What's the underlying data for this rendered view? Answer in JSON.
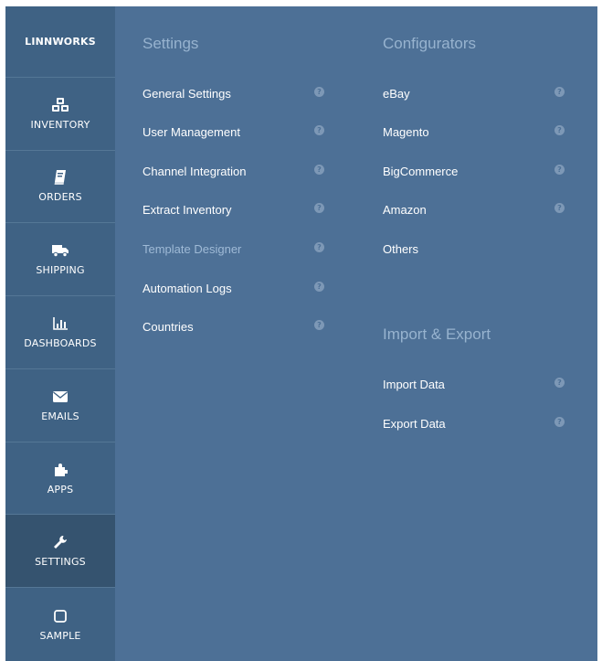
{
  "sidebar": {
    "brand": "LINNWORKS",
    "items": [
      {
        "label": "INVENTORY",
        "icon": "cubes-icon"
      },
      {
        "label": "ORDERS",
        "icon": "book-icon"
      },
      {
        "label": "SHIPPING",
        "icon": "truck-icon"
      },
      {
        "label": "DASHBOARDS",
        "icon": "bar-chart-icon"
      },
      {
        "label": "EMAILS",
        "icon": "envelope-icon"
      },
      {
        "label": "APPS",
        "icon": "puzzle-icon"
      },
      {
        "label": "SETTINGS",
        "icon": "wrench-icon",
        "active": true
      },
      {
        "label": "SAMPLE",
        "icon": "square-icon"
      }
    ]
  },
  "settings": {
    "title": "Settings",
    "items": [
      {
        "label": "General Settings"
      },
      {
        "label": "User Management"
      },
      {
        "label": "Channel Integration"
      },
      {
        "label": "Extract Inventory"
      },
      {
        "label": "Template Designer"
      },
      {
        "label": "Automation Logs"
      },
      {
        "label": "Countries"
      }
    ]
  },
  "configurators": {
    "title": "Configurators",
    "items": [
      {
        "label": "eBay"
      },
      {
        "label": "Magento"
      },
      {
        "label": "BigCommerce"
      },
      {
        "label": "Amazon"
      },
      {
        "label": "Others"
      }
    ]
  },
  "import_export": {
    "title": "Import & Export",
    "items": [
      {
        "label": "Import Data"
      },
      {
        "label": "Export Data"
      }
    ]
  },
  "help_glyph": "?",
  "colors": {
    "sidebar": "#3f6284",
    "sidebar_active": "#35536f",
    "panel": "#4d7096",
    "section_title": "#97b3cf",
    "dim_item": "#9fbad6"
  }
}
